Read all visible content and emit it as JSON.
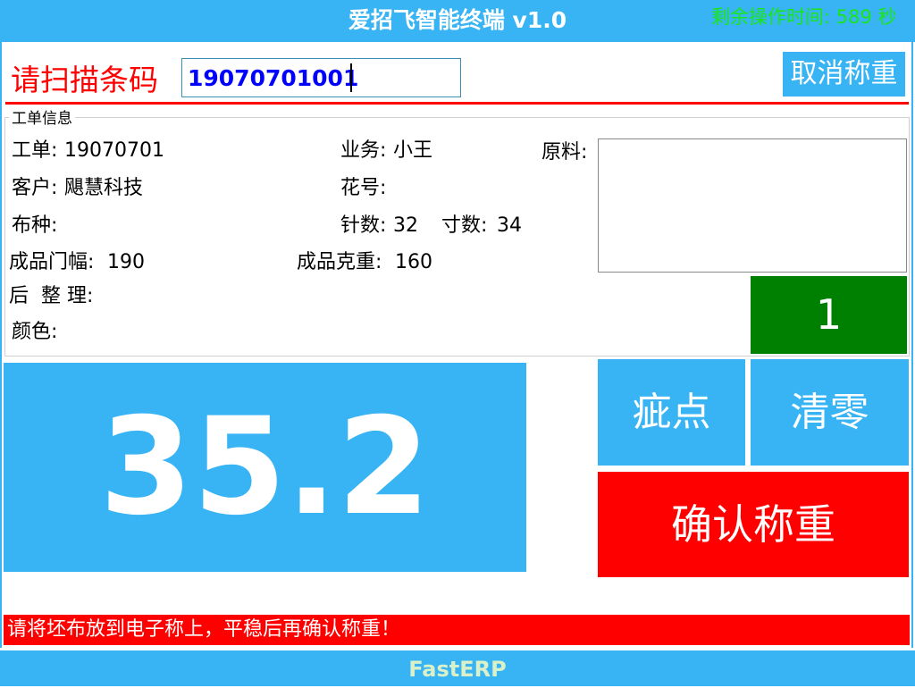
{
  "window": {
    "title": "爱招飞智能终端 v1.0",
    "timer_text": "剩余操作时间: 589 秒"
  },
  "scan": {
    "label": "请扫描条码",
    "value": "19070701001",
    "cancel_label": "取消称重"
  },
  "work_order": {
    "group_title": "工单信息",
    "fields": {
      "order_label": "工单:",
      "order_value": "19070701",
      "sales_label": "业务:",
      "sales_value": "小王",
      "material_label": "原料:",
      "customer_label": "客户:",
      "customer_value": "飓慧科技",
      "pattern_label": "花号:",
      "pattern_value": "",
      "fabric_label": "布种:",
      "fabric_value": "",
      "needles_label": "针数:",
      "needles_value": "32",
      "inch_label": "寸数:",
      "inch_value": "34",
      "width_label": "成品门幅:",
      "width_value": "190",
      "gsm_label": "成品克重:",
      "gsm_value": "160",
      "finishing_label": "后  整 理:",
      "finishing_value": "",
      "color_label": "颜色:",
      "color_value": ""
    },
    "count": "1"
  },
  "scale": {
    "weight": "35.2"
  },
  "actions": {
    "blemish_label": "疵点",
    "zero_label": "清零",
    "confirm_label": "确认称重"
  },
  "status": {
    "message": "请将坯布放到电子称上，平稳后再确认称重！"
  },
  "footer": {
    "brand": "FastERP"
  },
  "colors": {
    "accent_blue": "#38b4f4",
    "alert_red": "#ff0000",
    "count_green": "#008000",
    "timer_green": "#19e619",
    "input_text_blue": "#0000ff"
  }
}
